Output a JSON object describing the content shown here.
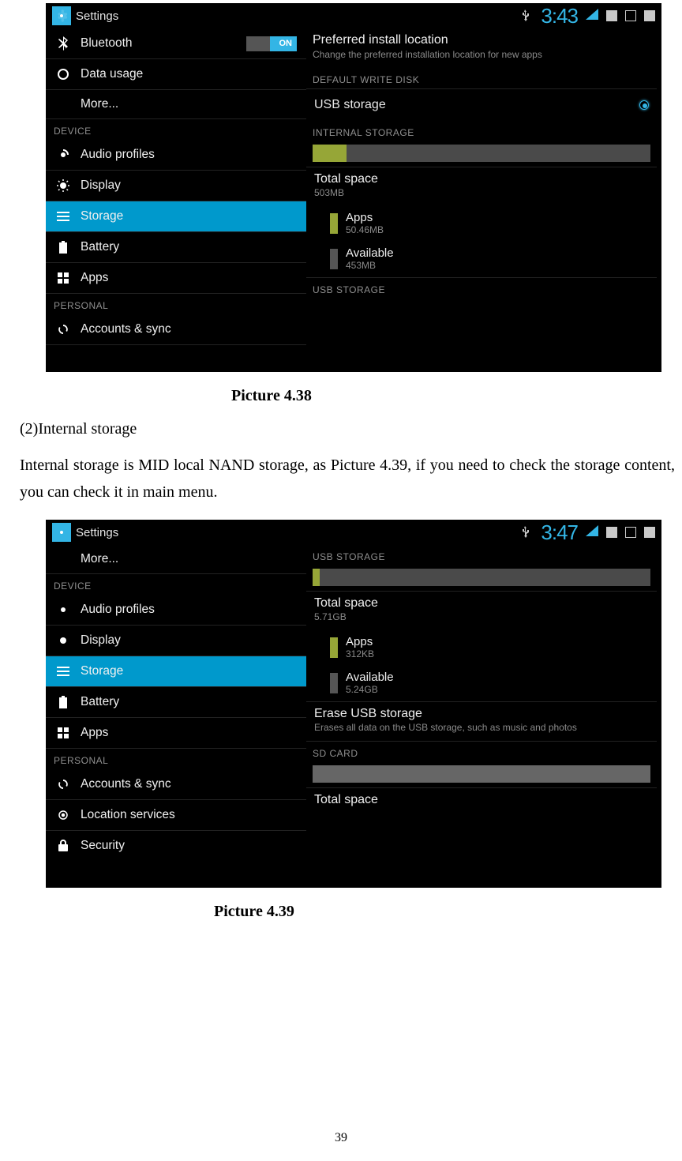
{
  "captions": {
    "p438": "Picture 4.38",
    "p439": "Picture 4.39"
  },
  "text": {
    "h": "(2)Internal storage",
    "p": "Internal storage is MID local NAND storage, as Picture 4.39, if you need to check the storage content, you can check it in main menu."
  },
  "page_number": "39",
  "shot1": {
    "status": {
      "app": "Settings",
      "clock": "3:43"
    },
    "left": {
      "items": [
        {
          "icon": "bluetooth-icon",
          "label": "Bluetooth",
          "toggle": "ON"
        },
        {
          "icon": "data-usage-icon",
          "label": "Data usage"
        },
        {
          "icon": "",
          "label": "More..."
        }
      ],
      "cat1": "DEVICE",
      "device": [
        {
          "icon": "audio-profiles-icon",
          "label": "Audio profiles"
        },
        {
          "icon": "display-icon",
          "label": "Display"
        },
        {
          "icon": "storage-icon",
          "label": "Storage",
          "active": true
        },
        {
          "icon": "battery-icon",
          "label": "Battery"
        },
        {
          "icon": "apps-icon",
          "label": "Apps"
        }
      ],
      "cat2": "PERSONAL",
      "personal": [
        {
          "icon": "sync-icon",
          "label": "Accounts & sync"
        }
      ]
    },
    "right": {
      "pref_t": "Preferred install location",
      "pref_s": "Change the preferred installation location for new apps",
      "cat_disk": "DEFAULT WRITE DISK",
      "usb": "USB storage",
      "cat_internal": "INTERNAL STORAGE",
      "total_t": "Total space",
      "total_s": "503MB",
      "apps_t": "Apps",
      "apps_s": "50.46MB",
      "avail_t": "Available",
      "avail_s": "453MB",
      "cat_usb": "USB STORAGE"
    }
  },
  "shot2": {
    "status": {
      "app": "Settings",
      "clock": "3:47"
    },
    "left": {
      "items": [
        {
          "icon": "",
          "label": "More..."
        }
      ],
      "cat1": "DEVICE",
      "device": [
        {
          "icon": "audio-profiles-icon",
          "label": "Audio profiles"
        },
        {
          "icon": "display-icon",
          "label": "Display"
        },
        {
          "icon": "storage-icon",
          "label": "Storage",
          "active": true
        },
        {
          "icon": "battery-icon",
          "label": "Battery"
        },
        {
          "icon": "apps-icon",
          "label": "Apps"
        }
      ],
      "cat2": "PERSONAL",
      "personal": [
        {
          "icon": "sync-icon",
          "label": "Accounts & sync"
        },
        {
          "icon": "location-icon",
          "label": "Location services"
        },
        {
          "icon": "security-icon",
          "label": "Security"
        }
      ]
    },
    "right": {
      "cat_usb": "USB STORAGE",
      "total_t": "Total space",
      "total_s": "5.71GB",
      "apps_t": "Apps",
      "apps_s": "312KB",
      "avail_t": "Available",
      "avail_s": "5.24GB",
      "erase_t": "Erase USB storage",
      "erase_s": "Erases all data on the USB storage, such as music and photos",
      "cat_sd": "SD CARD",
      "partial": "Total space"
    }
  },
  "chart_data": [
    {
      "type": "bar",
      "title": "Internal storage usage (Picture 4.38)",
      "categories": [
        "Apps",
        "Available"
      ],
      "values": [
        50.46,
        453
      ],
      "ylim": [
        0,
        503
      ],
      "ylabel": "MB",
      "total": 503
    },
    {
      "type": "bar",
      "title": "USB storage usage (Picture 4.39)",
      "categories": [
        "Apps",
        "Available"
      ],
      "values": [
        0.000312,
        5.24
      ],
      "ylim": [
        0,
        5.71
      ],
      "ylabel": "GB",
      "total": 5.71
    }
  ]
}
